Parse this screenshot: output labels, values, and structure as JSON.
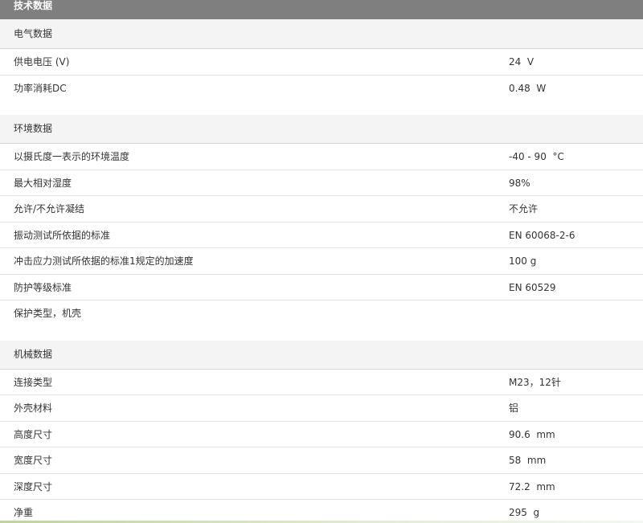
{
  "title": "技术数据",
  "sections": [
    {
      "heading": "电气数据",
      "rows": [
        {
          "label": "供电电压 (V)",
          "value": "24  V"
        },
        {
          "label": "功率消耗DC",
          "value": "0.48  W"
        }
      ]
    },
    {
      "heading": "环境数据",
      "rows": [
        {
          "label": "以摄氏度一表示的环境温度",
          "value": "-40 - 90  °C"
        },
        {
          "label": "最大相对湿度",
          "value": "98%"
        },
        {
          "label": "允许/不允许凝结",
          "value": "不允许"
        },
        {
          "label": "振动测试所依据的标准",
          "value": "EN 60068-2-6"
        },
        {
          "label": "冲击应力测试所依据的标准1规定的加速度",
          "value": "100 g"
        },
        {
          "label": "防护等级标准",
          "value": "EN 60529"
        },
        {
          "label": "保护类型，机壳",
          "value": ""
        }
      ]
    },
    {
      "heading": "机械数据",
      "rows": [
        {
          "label": "连接类型",
          "value": "M23，12针"
        },
        {
          "label": "外壳材料",
          "value": "铝"
        },
        {
          "label": "高度尺寸",
          "value": "90.6  mm"
        },
        {
          "label": "宽度尺寸",
          "value": "58  mm"
        },
        {
          "label": "深度尺寸",
          "value": "72.2  mm"
        },
        {
          "label": "净重",
          "value": "295  g"
        }
      ]
    }
  ]
}
